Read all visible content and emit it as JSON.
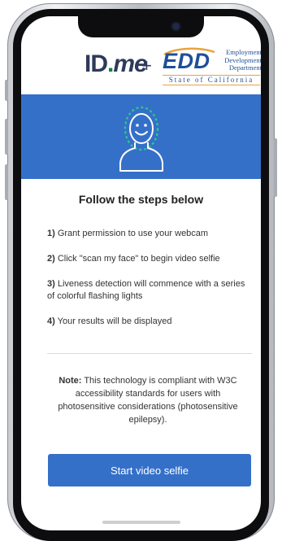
{
  "logos": {
    "idme_prefix": "ID",
    "idme_dot": ".",
    "idme_suffix": "me",
    "plus": "+",
    "edd_mark": "EDD",
    "edd_line1": "Employment",
    "edd_line2": "Development",
    "edd_line3": "Department",
    "edd_state": "State of California"
  },
  "hero": {
    "icon": "face-scan-icon",
    "bg_color": "#3570c8",
    "ring_color": "#2ec98b"
  },
  "content": {
    "heading": "Follow the steps below",
    "steps": [
      {
        "num": "1)",
        "text": " Grant permission to use your webcam"
      },
      {
        "num": "2)",
        "text": " Click \"scan my face\" to begin video selfie"
      },
      {
        "num": "3)",
        "text": " Liveness detection will commence with a series of colorful flashing lights"
      },
      {
        "num": "4)",
        "text": " Your results will be displayed"
      }
    ],
    "note_label": "Note:",
    "note_text": " This technology is compliant with W3C accessibility standards for users with photosensitive considerations (photosensitive epilepsy).",
    "cta_label": "Start video selfie"
  }
}
